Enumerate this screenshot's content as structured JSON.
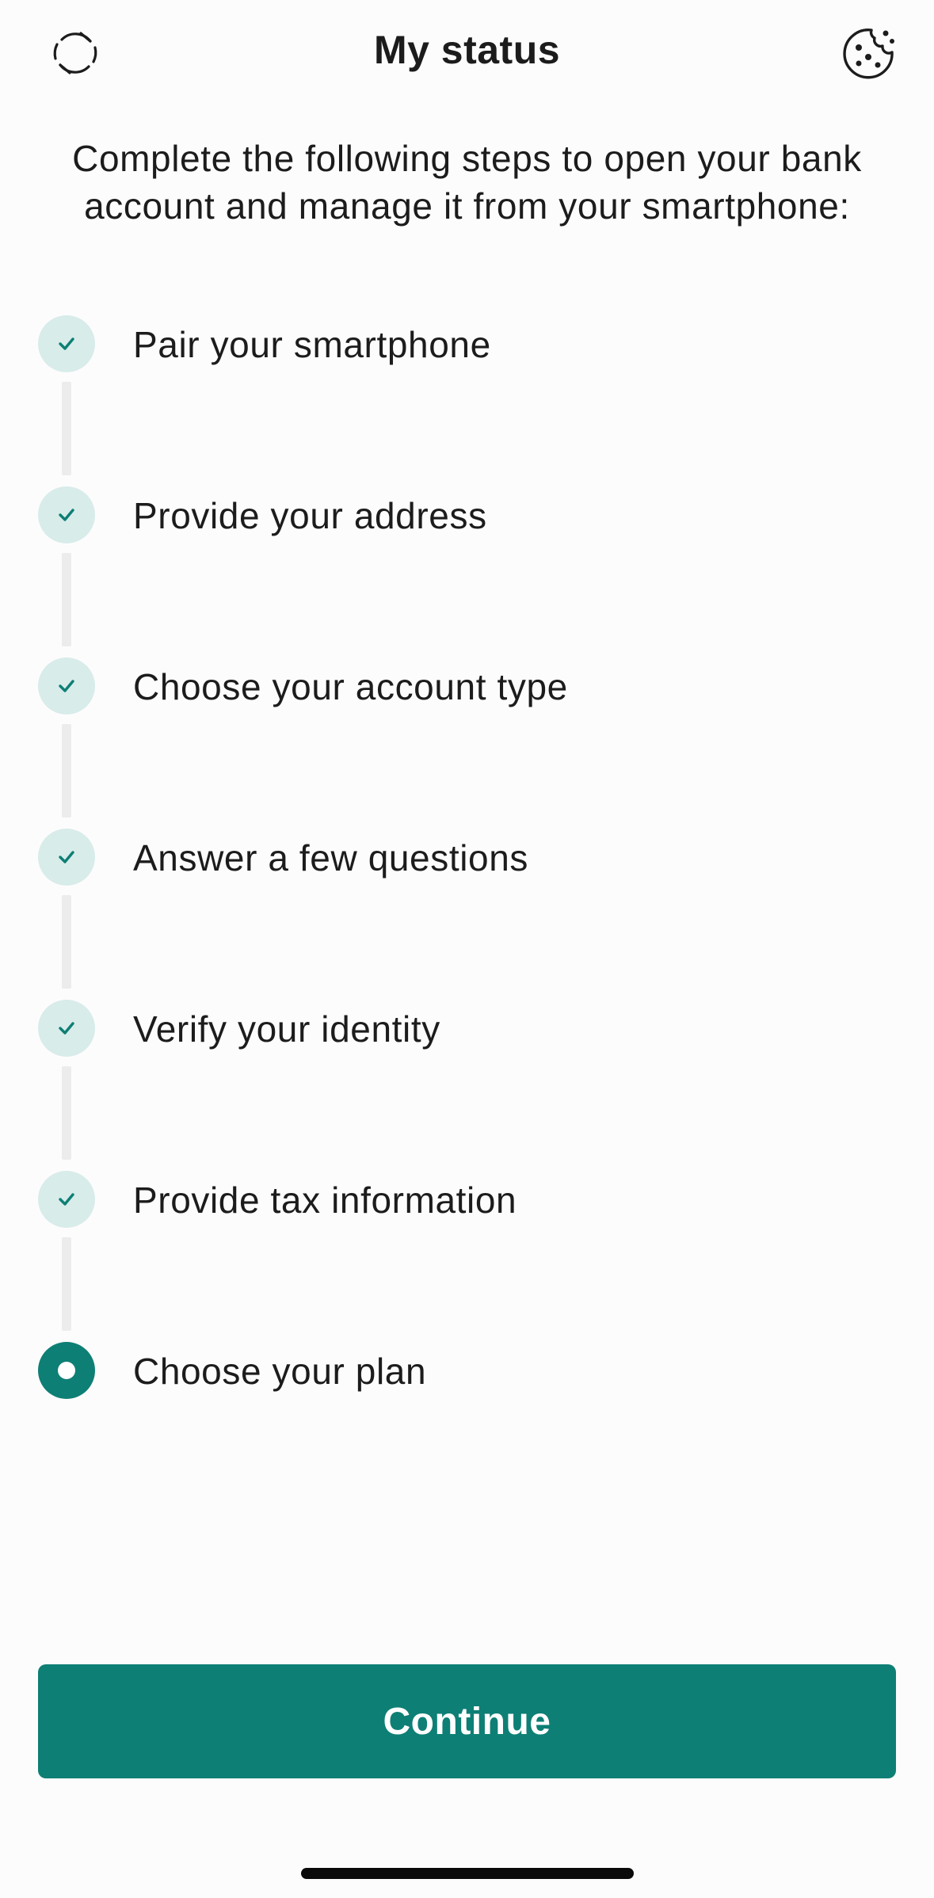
{
  "header": {
    "title": "My status",
    "left_icon": "refresh-icon",
    "right_icon": "cookie-icon"
  },
  "intro": "Complete the following steps to open your bank account and manage it from your smartphone:",
  "steps": [
    {
      "label": "Pair your smartphone",
      "status": "completed"
    },
    {
      "label": "Provide your address",
      "status": "completed"
    },
    {
      "label": "Choose your account type",
      "status": "completed"
    },
    {
      "label": "Answer a few questions",
      "status": "completed"
    },
    {
      "label": "Verify your identity",
      "status": "completed"
    },
    {
      "label": "Provide tax information",
      "status": "completed"
    },
    {
      "label": "Choose your plan",
      "status": "current"
    }
  ],
  "continue_label": "Continue",
  "colors": {
    "accent": "#0e7f75",
    "completed_marker_bg": "#d8ecea",
    "connector": "#ececec"
  }
}
